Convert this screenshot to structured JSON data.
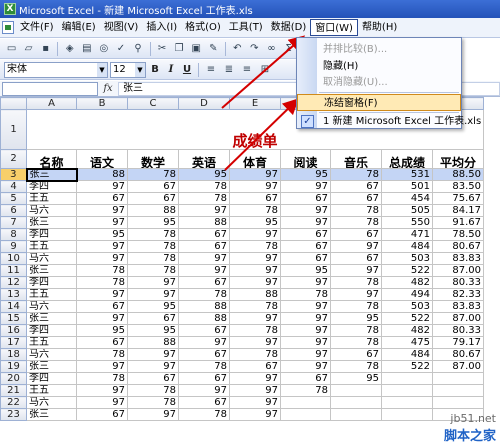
{
  "window": {
    "title": "Microsoft Excel - 新建 Microsoft Excel 工作表.xls",
    "app_icon": "X"
  },
  "menu": {
    "items": [
      "文件(F)",
      "编辑(E)",
      "视图(V)",
      "插入(I)",
      "格式(O)",
      "工具(T)",
      "数据(D)",
      "窗口(W)",
      "帮助(H)"
    ],
    "active_index": 7
  },
  "toolbar": {
    "font_name": "宋体",
    "font_size": "12",
    "bold": "B",
    "italic": "I",
    "underline": "U"
  },
  "formula_bar": {
    "name_box": "",
    "fx": "fx",
    "content": "张三"
  },
  "window_menu": {
    "items": [
      {
        "label": "并排比较(B)...",
        "disabled": true
      },
      {
        "label": "隐藏(H)",
        "disabled": false
      },
      {
        "label": "取消隐藏(U)...",
        "disabled": true
      },
      {
        "label": "冻结窗格(F)",
        "disabled": false,
        "highlighted": true
      },
      {
        "label": "1 新建 Microsoft Excel 工作表.xls",
        "disabled": false,
        "checked": true
      }
    ],
    "more": "»"
  },
  "sheet": {
    "columns": [
      "A",
      "B",
      "C",
      "D",
      "E",
      "F",
      "G",
      "H",
      "I"
    ],
    "title": "成绩单",
    "headers": [
      "名称",
      "语文",
      "数学",
      "英语",
      "体育",
      "阅读",
      "音乐",
      "总成绩",
      "平均分"
    ],
    "selected_row": 3,
    "rows": [
      [
        "3",
        "张三",
        "88",
        "78",
        "95",
        "97",
        "95",
        "78",
        "531",
        "88.50"
      ],
      [
        "4",
        "李四",
        "97",
        "67",
        "78",
        "97",
        "97",
        "67",
        "501",
        "83.50"
      ],
      [
        "5",
        "王五",
        "67",
        "67",
        "78",
        "67",
        "67",
        "67",
        "454",
        "75.67"
      ],
      [
        "6",
        "马六",
        "97",
        "88",
        "97",
        "78",
        "97",
        "78",
        "505",
        "84.17"
      ],
      [
        "7",
        "张三",
        "97",
        "95",
        "88",
        "95",
        "97",
        "78",
        "550",
        "91.67"
      ],
      [
        "8",
        "李四",
        "95",
        "78",
        "67",
        "97",
        "67",
        "67",
        "471",
        "78.50"
      ],
      [
        "9",
        "王五",
        "97",
        "78",
        "67",
        "78",
        "67",
        "97",
        "484",
        "80.67"
      ],
      [
        "10",
        "马六",
        "97",
        "78",
        "97",
        "97",
        "67",
        "67",
        "503",
        "83.83"
      ],
      [
        "11",
        "张三",
        "78",
        "78",
        "97",
        "97",
        "95",
        "97",
        "522",
        "87.00"
      ],
      [
        "12",
        "李四",
        "78",
        "97",
        "67",
        "97",
        "97",
        "78",
        "482",
        "80.33"
      ],
      [
        "13",
        "王五",
        "97",
        "97",
        "78",
        "88",
        "78",
        "97",
        "494",
        "82.33"
      ],
      [
        "14",
        "马六",
        "67",
        "95",
        "88",
        "78",
        "97",
        "78",
        "503",
        "83.83"
      ],
      [
        "15",
        "张三",
        "97",
        "67",
        "88",
        "97",
        "97",
        "95",
        "522",
        "87.00"
      ],
      [
        "16",
        "李四",
        "95",
        "95",
        "67",
        "78",
        "97",
        "78",
        "482",
        "80.33"
      ],
      [
        "17",
        "王五",
        "67",
        "88",
        "97",
        "97",
        "97",
        "78",
        "475",
        "79.17"
      ],
      [
        "18",
        "马六",
        "78",
        "97",
        "67",
        "78",
        "97",
        "67",
        "484",
        "80.67"
      ],
      [
        "19",
        "张三",
        "97",
        "97",
        "78",
        "67",
        "97",
        "78",
        "522",
        "87.00"
      ],
      [
        "20",
        "李四",
        "78",
        "67",
        "67",
        "97",
        "67",
        "95",
        "",
        ""
      ],
      [
        "21",
        "王五",
        "97",
        "78",
        "97",
        "97",
        "78",
        "",
        "",
        ""
      ],
      [
        "22",
        "马六",
        "97",
        "78",
        "67",
        "97",
        "",
        "",
        "",
        ""
      ],
      [
        "23",
        "张三",
        "67",
        "97",
        "78",
        "97",
        "",
        "",
        "",
        ""
      ]
    ]
  },
  "watermark": {
    "url": "jb51.net",
    "name": "脚本之家"
  },
  "colors": {
    "title_red": "#c00000",
    "arrow_red": "#d40000",
    "selection": "#c4d5f5"
  }
}
